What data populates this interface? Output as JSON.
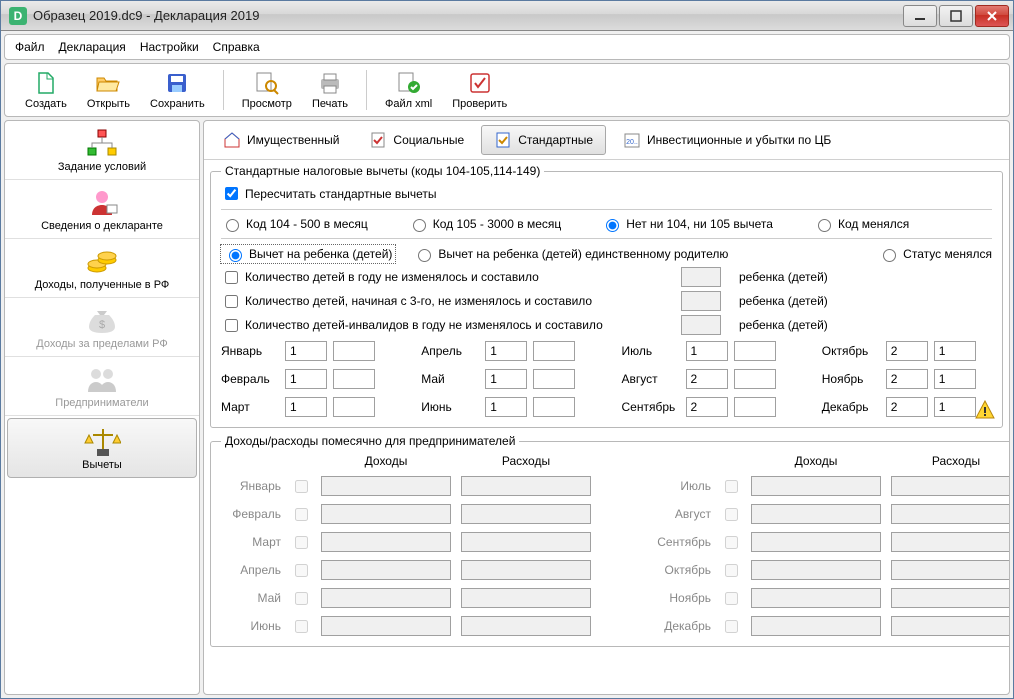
{
  "window": {
    "title": "Образец 2019.dc9 - Декларация 2019"
  },
  "menu": {
    "file": "Файл",
    "decl": "Декларация",
    "settings": "Настройки",
    "help": "Справка"
  },
  "toolbar": {
    "create": "Создать",
    "open": "Открыть",
    "save": "Сохранить",
    "preview": "Просмотр",
    "print": "Печать",
    "xml": "Файл xml",
    "check": "Проверить"
  },
  "sidebar": {
    "conditions": "Задание условий",
    "declarant": "Сведения о декларанте",
    "income_rf": "Доходы, полученные в РФ",
    "income_abroad": "Доходы за пределами РФ",
    "entrepreneur": "Предприниматели",
    "deductions": "Вычеты"
  },
  "tabs": {
    "property": "Имущественный",
    "social": "Социальные",
    "standard": "Стандартные",
    "invest": "Инвестиционные и убытки по ЦБ"
  },
  "std": {
    "legend": "Стандартные налоговые вычеты (коды 104-105,114-149)",
    "recalc": "Пересчитать стандартные вычеты",
    "code104": "Код 104 - 500 в месяц",
    "code105": "Код 105 - 3000 в месяц",
    "none": "Нет ни 104, ни 105 вычета",
    "changed": "Код менялся",
    "child": "Вычет на ребенка (детей)",
    "child_single": "Вычет на ребенка (детей) единственному родителю",
    "status_changed": "Статус менялся",
    "count1": "Количество детей в году не изменялось и составило",
    "count2": "Количество детей, начиная с 3-го, не изменялось и составило",
    "count3": "Количество детей-инвалидов в году не изменялось и составило",
    "children_word": "ребенка (детей)",
    "months": {
      "jan": {
        "label": "Январь",
        "v1": "1",
        "v2": ""
      },
      "feb": {
        "label": "Февраль",
        "v1": "1",
        "v2": ""
      },
      "mar": {
        "label": "Март",
        "v1": "1",
        "v2": ""
      },
      "apr": {
        "label": "Апрель",
        "v1": "1",
        "v2": ""
      },
      "may": {
        "label": "Май",
        "v1": "1",
        "v2": ""
      },
      "jun": {
        "label": "Июнь",
        "v1": "1",
        "v2": ""
      },
      "jul": {
        "label": "Июль",
        "v1": "1",
        "v2": ""
      },
      "aug": {
        "label": "Август",
        "v1": "2",
        "v2": ""
      },
      "sep": {
        "label": "Сентябрь",
        "v1": "2",
        "v2": ""
      },
      "oct": {
        "label": "Октябрь",
        "v1": "2",
        "v2": "1"
      },
      "nov": {
        "label": "Ноябрь",
        "v1": "2",
        "v2": "1"
      },
      "dec": {
        "label": "Декабрь",
        "v1": "2",
        "v2": "1"
      }
    }
  },
  "ie": {
    "legend": "Доходы/расходы помесячно для предпринимателей",
    "income": "Доходы",
    "expense": "Расходы",
    "months": {
      "jan": "Январь",
      "feb": "Февраль",
      "mar": "Март",
      "apr": "Апрель",
      "may": "Май",
      "jun": "Июнь",
      "jul": "Июль",
      "aug": "Август",
      "sep": "Сентябрь",
      "oct": "Октябрь",
      "nov": "Ноябрь",
      "dec": "Декабрь"
    }
  }
}
